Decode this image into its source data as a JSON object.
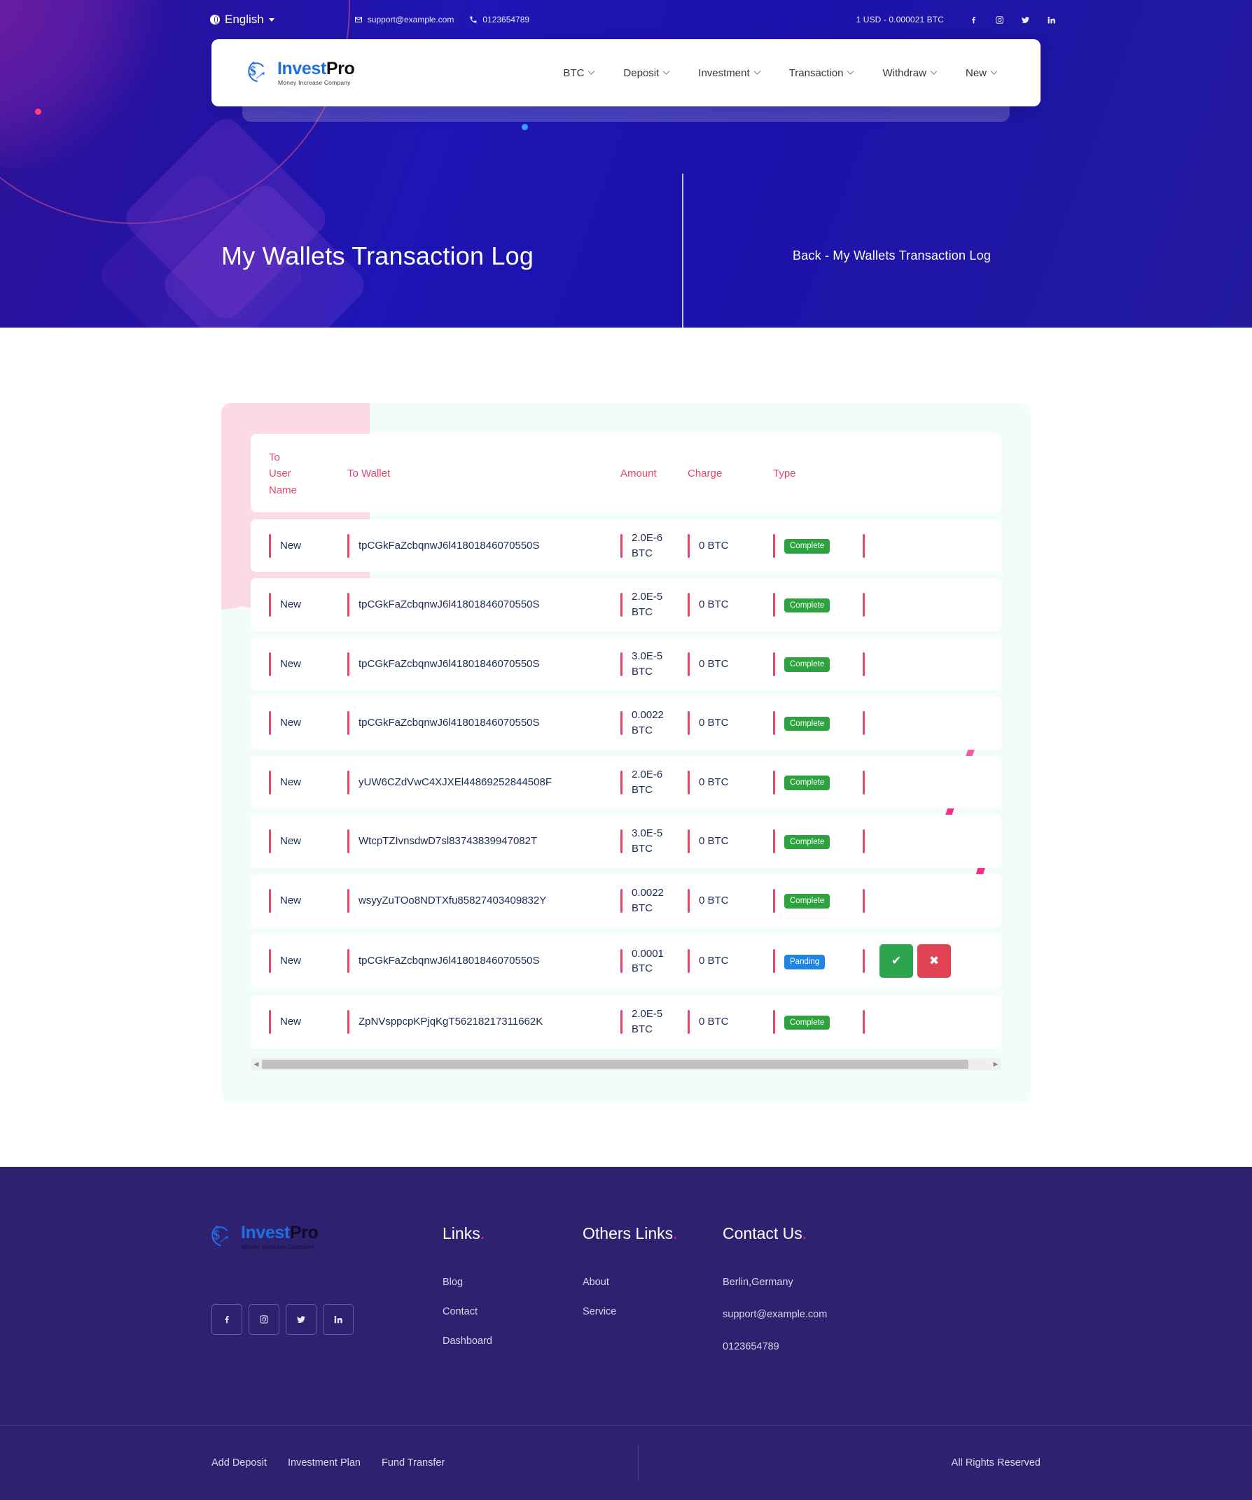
{
  "topbar": {
    "language": "English",
    "email": "support@example.com",
    "phone": "0123654789",
    "rate": "1 USD - 0.000021 BTC",
    "socials": [
      "facebook-icon",
      "instagram-icon",
      "twitter-icon",
      "linkedin-icon"
    ]
  },
  "brand": {
    "name_first": "Invest",
    "name_second": "Pro",
    "tagline": "Money Increase Company"
  },
  "nav": {
    "items": [
      {
        "label": "BTC"
      },
      {
        "label": "Deposit"
      },
      {
        "label": "Investment"
      },
      {
        "label": "Transaction"
      },
      {
        "label": "Withdraw"
      },
      {
        "label": "New"
      }
    ]
  },
  "hero": {
    "title": "My Wallets Transaction Log",
    "breadcrumb": "Back  -  My Wallets Transaction Log"
  },
  "table": {
    "columns": {
      "to_user_name_l1": "To",
      "to_user_name_l2": "User",
      "to_user_name_l3": "Name",
      "to_wallet": "To Wallet",
      "amount": "Amount",
      "charge": "Charge",
      "type": "Type"
    },
    "rows": [
      {
        "user": "New",
        "wallet": "tpCGkFaZcbqnwJ6l41801846070550S",
        "amount": "2.0E-6 BTC",
        "charge": "0 BTC",
        "status": "Complete",
        "status_kind": "complete",
        "actions": false
      },
      {
        "user": "New",
        "wallet": "tpCGkFaZcbqnwJ6l41801846070550S",
        "amount": "2.0E-5 BTC",
        "charge": "0 BTC",
        "status": "Complete",
        "status_kind": "complete",
        "actions": false
      },
      {
        "user": "New",
        "wallet": "tpCGkFaZcbqnwJ6l41801846070550S",
        "amount": "3.0E-5 BTC",
        "charge": "0 BTC",
        "status": "Complete",
        "status_kind": "complete",
        "actions": false
      },
      {
        "user": "New",
        "wallet": "tpCGkFaZcbqnwJ6l41801846070550S",
        "amount": "0.0022 BTC",
        "charge": "0 BTC",
        "status": "Complete",
        "status_kind": "complete",
        "actions": false
      },
      {
        "user": "New",
        "wallet": "yUW6CZdVwC4XJXEl44869252844508F",
        "amount": "2.0E-6 BTC",
        "charge": "0 BTC",
        "status": "Complete",
        "status_kind": "complete",
        "actions": false
      },
      {
        "user": "New",
        "wallet": "WtcpTZIvnsdwD7sl83743839947082T",
        "amount": "3.0E-5 BTC",
        "charge": "0 BTC",
        "status": "Complete",
        "status_kind": "complete",
        "actions": false
      },
      {
        "user": "New",
        "wallet": "wsyyZuTOo8NDTXfu85827403409832Y",
        "amount": "0.0022 BTC",
        "charge": "0 BTC",
        "status": "Complete",
        "status_kind": "complete",
        "actions": false
      },
      {
        "user": "New",
        "wallet": "tpCGkFaZcbqnwJ6l41801846070550S",
        "amount": "0.0001 BTC",
        "charge": "0 BTC",
        "status": "Panding",
        "status_kind": "pending",
        "actions": true
      },
      {
        "user": "New",
        "wallet": "ZpNVsppcpKPjqKgT56218217311662K",
        "amount": "2.0E-5 BTC",
        "charge": "0 BTC",
        "status": "Complete",
        "status_kind": "complete",
        "actions": false
      }
    ],
    "action_approve": "✔",
    "action_reject": "✖",
    "scroll_left": "◀",
    "scroll_right": "▶"
  },
  "footer": {
    "columns": [
      {
        "heading": "Links",
        "links": [
          "Blog",
          "Contact",
          "Dashboard"
        ]
      },
      {
        "heading": "Others Links",
        "links": [
          "About",
          "Service"
        ]
      }
    ],
    "contact": {
      "heading": "Contact Us",
      "address": "Berlin,Germany",
      "email": "support@example.com",
      "phone": "0123654789"
    },
    "socials": [
      "facebook-icon",
      "instagram-icon",
      "twitter-icon",
      "linkedin-icon"
    ],
    "bottom_links": [
      "Add Deposit",
      "Investment Plan",
      "Fund Transfer"
    ],
    "rights": "All Rights Reserved"
  },
  "colors": {
    "hero_bg": "#1d15b4",
    "accent_pink": "#e8446b",
    "badge_complete": "#2ca33f",
    "badge_pending": "#2084e4",
    "approve": "#2ea44f",
    "reject": "#e04352",
    "footer_bg": "#2e2270",
    "card_bg": "#f2fdfb",
    "brand_blue": "#1f6fe0"
  }
}
